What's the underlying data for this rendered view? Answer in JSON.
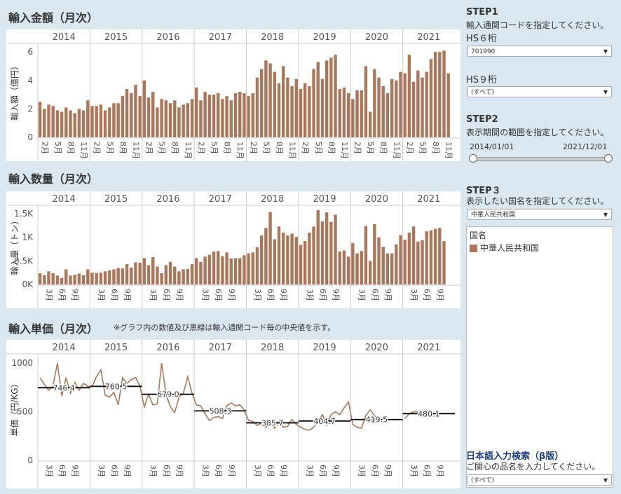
{
  "colors": {
    "bar": "#a9775b",
    "median": "#000000",
    "panel_bg": "#dbe7f0"
  },
  "years": [
    "2014",
    "2015",
    "2016",
    "2017",
    "2018",
    "2019",
    "2020",
    "2021"
  ],
  "panel1": {
    "title": "輸入金額（月次）",
    "ylabel": "輸入額（億円）",
    "yticks": [
      "6",
      "4",
      "2",
      "0"
    ],
    "xticks": [
      "2月",
      "5月",
      "8月",
      "11月"
    ]
  },
  "panel2": {
    "title": "輸入数量（月次）",
    "ylabel": "輸入量（トン）",
    "yticks": [
      "1.5K",
      "1K",
      "0.5K",
      "0K"
    ],
    "xticks": [
      "3月",
      "6月",
      "9月"
    ]
  },
  "panel3": {
    "title": "輸入単価（月次）",
    "note": "※グラフ内の数値及び黒線は輸入通関コード毎の中央値を示す。",
    "ylabel": "単価（円/KG）",
    "yticks": [
      "1000",
      "500",
      "0"
    ],
    "xticks": [
      "3月",
      "6月",
      "9月"
    ]
  },
  "side": {
    "step1": "STEP1",
    "step1_text": "輸入通関コードを指定してください。",
    "hs6_label": "HS６桁",
    "hs6_value": "701990",
    "hs9_label": "HS９桁",
    "hs9_value": "(すべて)",
    "step2": "STEP2",
    "step2_text": "表示期間の範囲を指定してください。",
    "date_from": "2014/01/01",
    "date_to": "2021/12/01",
    "step3": "STEP３",
    "step3_text": "表示したい国名を指定してください。",
    "country_value": "中華人民共和国",
    "legend_title": "国名",
    "legend_item": "中華人民共和国",
    "search_title": "日本語入力検索（β版）",
    "search_text": "ご関心の品名を入力してください。",
    "search_value": "(すべて)"
  },
  "chart_data": [
    {
      "type": "bar",
      "title": "輸入金額（月次）",
      "ylabel": "輸入額（億円）",
      "ylim": [
        0,
        6.5
      ],
      "x_start": "2014-01",
      "n_months": 96,
      "values": [
        2.5,
        2.0,
        2.3,
        2.2,
        1.9,
        1.8,
        2.1,
        1.9,
        1.7,
        2.0,
        1.9,
        2.6,
        2.2,
        2.2,
        2.3,
        1.9,
        2.1,
        2.4,
        2.4,
        2.9,
        3.4,
        3.1,
        3.7,
        2.9,
        4.0,
        2.8,
        3.2,
        2.1,
        2.7,
        2.6,
        2.4,
        2.6,
        2.1,
        2.3,
        2.4,
        2.7,
        3.5,
        2.6,
        3.2,
        3.0,
        3.0,
        3.1,
        2.7,
        2.9,
        2.6,
        3.1,
        3.2,
        3.1,
        2.9,
        3.1,
        4.2,
        4.8,
        5.4,
        5.2,
        4.6,
        3.8,
        5.0,
        4.2,
        3.6,
        4.1,
        3.4,
        3.8,
        3.6,
        4.8,
        5.3,
        4.1,
        5.4,
        5.6,
        5.8,
        3.4,
        3.5,
        3.1,
        2.7,
        3.3,
        3.3,
        5.0,
        1.8,
        4.8,
        4.2,
        3.6,
        3.1,
        4.1,
        4.0,
        4.6,
        4.5,
        5.8,
        3.9,
        4.7,
        4.2,
        4.6,
        5.5,
        6.0,
        6.0,
        6.1,
        4.5,
        0
      ]
    },
    {
      "type": "bar",
      "title": "輸入数量（月次）",
      "ylabel": "輸入量（トン）",
      "ylim": [
        0,
        1650
      ],
      "x_start": "2014-01",
      "n_months": 96,
      "values": [
        240,
        200,
        280,
        240,
        190,
        140,
        320,
        190,
        210,
        230,
        200,
        320,
        250,
        240,
        250,
        280,
        300,
        320,
        350,
        340,
        430,
        360,
        470,
        460,
        560,
        410,
        580,
        380,
        240,
        410,
        480,
        380,
        280,
        320,
        330,
        430,
        560,
        480,
        590,
        630,
        700,
        710,
        600,
        680,
        550,
        560,
        560,
        620,
        660,
        680,
        790,
        1040,
        1200,
        1540,
        960,
        1230,
        1100,
        1040,
        1080,
        1010,
        840,
        920,
        1100,
        1230,
        1580,
        1340,
        1530,
        1330,
        1480,
        700,
        720,
        590,
        880,
        660,
        710,
        1240,
        500,
        1280,
        1000,
        800,
        660,
        660,
        850,
        1050,
        950,
        1100,
        1230,
        910,
        940,
        1130,
        1150,
        1180,
        1200,
        920,
        0,
        0
      ]
    },
    {
      "type": "line",
      "title": "輸入単価（月次）",
      "ylabel": "単価（円/KG）",
      "ylim": [
        0,
        1080
      ],
      "x_start": "2014-01",
      "n_months": 96,
      "values": [
        850,
        780,
        720,
        770,
        1000,
        660,
        850,
        690,
        800,
        720,
        790,
        760,
        760,
        860,
        930,
        670,
        650,
        700,
        570,
        850,
        790,
        830,
        850,
        760,
        550,
        680,
        570,
        580,
        1000,
        680,
        550,
        490,
        650,
        690,
        860,
        690,
        570,
        560,
        480,
        410,
        440,
        450,
        430,
        560,
        590,
        560,
        570,
        520,
        410,
        400,
        360,
        380,
        340,
        410,
        330,
        420,
        340,
        350,
        420,
        370,
        340,
        320,
        310,
        340,
        400,
        470,
        360,
        470,
        500,
        470,
        540,
        600,
        370,
        340,
        330,
        460,
        520,
        460,
        420,
        420,
        430,
        null,
        null,
        null,
        430,
        480,
        500,
        500,
        null,
        null,
        null,
        null,
        null,
        null,
        null,
        null
      ],
      "medians": [
        746.4,
        760.5,
        679.0,
        508.3,
        385.7,
        404.7,
        419.5,
        480.1
      ]
    }
  ]
}
